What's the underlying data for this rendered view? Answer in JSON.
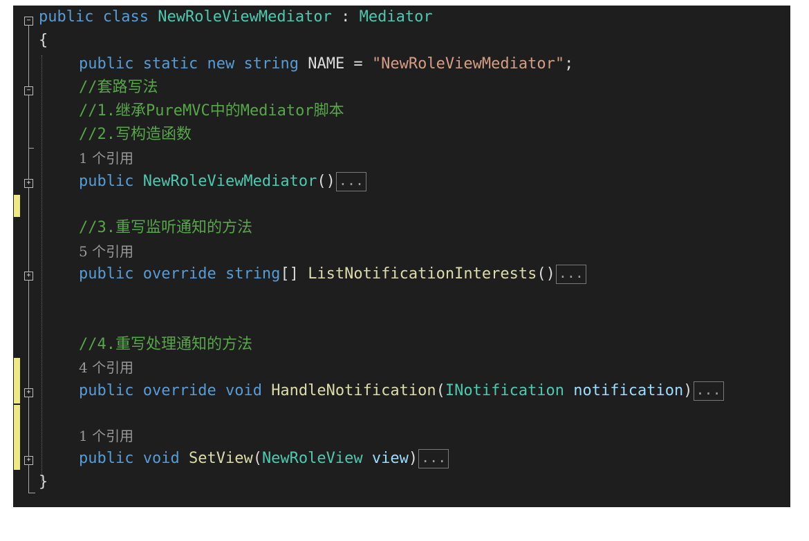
{
  "code": {
    "class_decl": {
      "kw1": "public",
      "kw2": "class",
      "class_name": "NewRoleViewMediator",
      "sep": " : ",
      "base": "Mediator"
    },
    "open_brace": "{",
    "close_brace": "}",
    "name_field": {
      "kw1": "public",
      "kw2": "static",
      "kw3": "new",
      "type": "string",
      "name": "NAME",
      "eq": " = ",
      "value": "\"NewRoleViewMediator\"",
      "end": ";"
    },
    "comments": {
      "c0": "//套路写法",
      "c1": "//1.继承PureMVC中的Mediator脚本",
      "c2": "//2.写构造函数",
      "c3": "//3.重写监听通知的方法",
      "c4": "//4.重写处理通知的方法"
    },
    "refs": {
      "r1": "1 个引用",
      "r2": "5 个引用",
      "r3": "4 个引用",
      "r4": "1 个引用"
    },
    "ctor": {
      "kw1": "public",
      "name": "NewRoleViewMediator",
      "args": "()"
    },
    "list_interests": {
      "kw1": "public",
      "kw2": "override",
      "type": "string",
      "brackets": "[]",
      "name": "ListNotificationInterests",
      "args": "()"
    },
    "handle": {
      "kw1": "public",
      "kw2": "override",
      "kw3": "void",
      "name": "HandleNotification",
      "open": "(",
      "ptype": "INotification",
      "pname": "notification",
      "close": ")"
    },
    "set_view": {
      "kw1": "public",
      "kw2": "void",
      "name": "SetView",
      "open": "(",
      "ptype": "NewRoleView",
      "pname": "view",
      "close": ")"
    },
    "collapsed": "...",
    "fold_minus": "−",
    "fold_plus": "+"
  },
  "colors": {
    "background": "#1e1e1e",
    "keyword": "#569cd6",
    "type": "#4ec9b0",
    "string": "#d69d85",
    "comment": "#57a64a",
    "change_marker": "#efe983"
  }
}
